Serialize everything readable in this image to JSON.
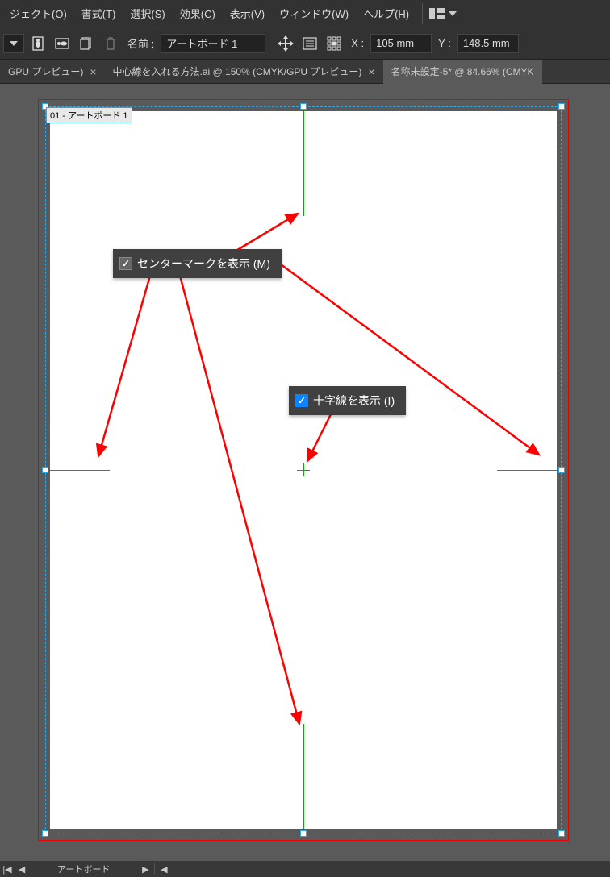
{
  "menu": {
    "object": "ジェクト(O)",
    "format": "書式(T)",
    "select": "選択(S)",
    "effect": "効果(C)",
    "view": "表示(V)",
    "window": "ウィンドウ(W)",
    "help": "ヘルプ(H)"
  },
  "control": {
    "name_label": "名前 :",
    "name_value": "アートボード 1",
    "x_label": "X :",
    "x_value": "105 mm",
    "y_label": "Y :",
    "y_value": "148.5 mm"
  },
  "tabs": {
    "t0": {
      "label": "GPU プレビュー)",
      "close": "×"
    },
    "t1": {
      "label": "中心線を入れる方法.ai @ 150% (CMYK/GPU プレビュー)",
      "close": "×"
    },
    "t2": {
      "label": "名称未設定-5* @ 84.66% (CMYK"
    }
  },
  "artboard": {
    "label": "01 - アートボード 1"
  },
  "options": {
    "center_mark": "センターマークを表示 (M)",
    "crosshair": "十字線を表示 (I)",
    "check": "✓"
  },
  "status": {
    "prev_first": "|◀",
    "prev": "◀",
    "artboard": "アートボード",
    "next": "▶",
    "next_last": "◀"
  }
}
